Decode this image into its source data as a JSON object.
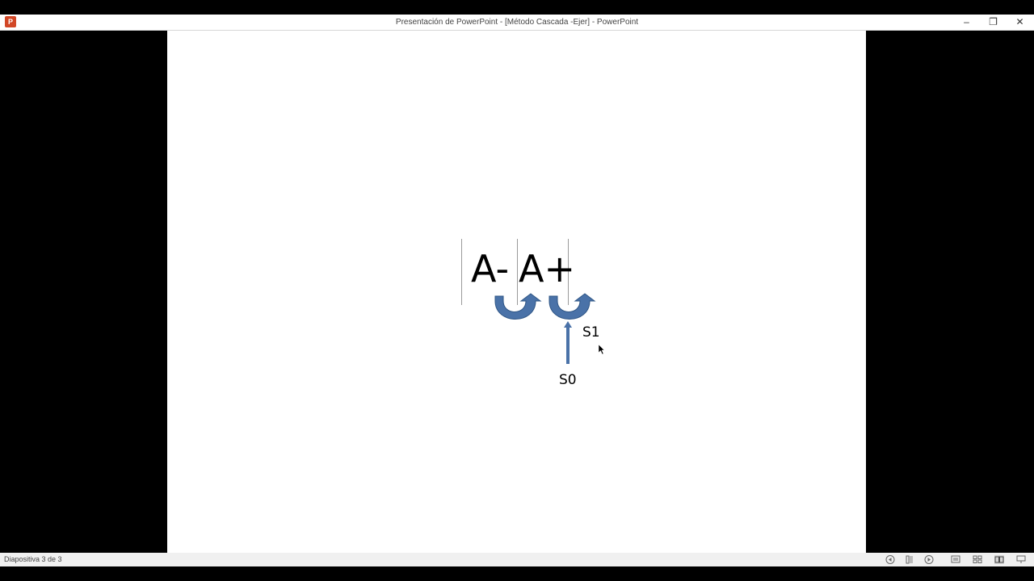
{
  "window": {
    "title": "Presentación de PowerPoint - [Método Cascada -Ejer] - PowerPoint",
    "app_icon_letter": "P",
    "controls": [
      {
        "name": "minimize",
        "glyph": "–"
      },
      {
        "name": "restore",
        "glyph": "❐"
      },
      {
        "name": "close",
        "glyph": "✕"
      }
    ]
  },
  "slide": {
    "text_a_minus": "A-",
    "text_a_plus": "A+",
    "label_s1": "S1",
    "label_s0": "S0",
    "arrow_color": "#4a72a8"
  },
  "statusbar": {
    "slide_indicator": "Diapositiva 3 de 3",
    "icons": [
      "previous-slide-icon",
      "slide-bar-icon",
      "next-slide-icon",
      "normal-view-icon",
      "slide-sorter-icon",
      "reading-view-icon",
      "slideshow-icon"
    ]
  }
}
